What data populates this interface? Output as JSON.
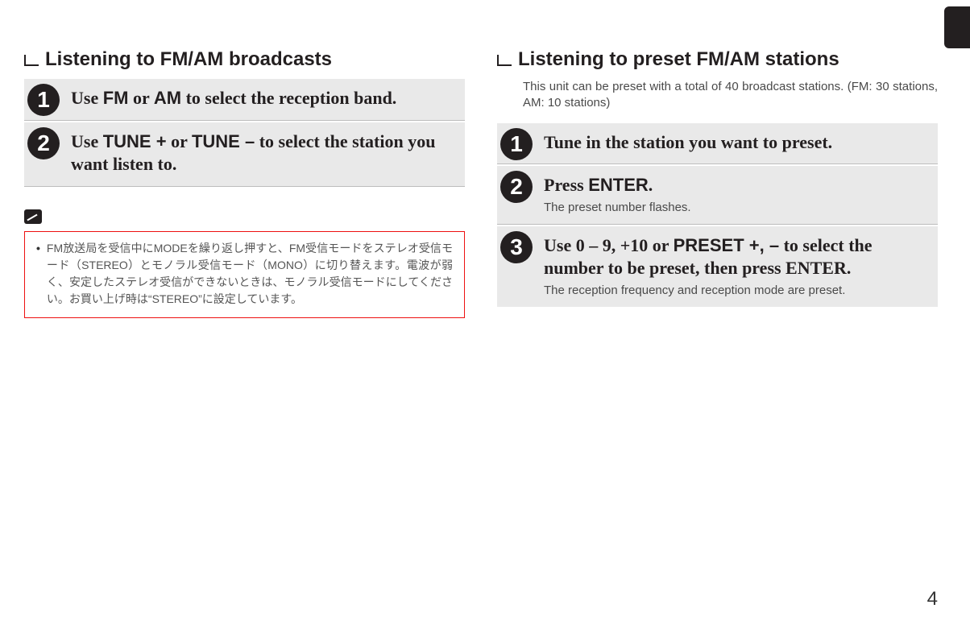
{
  "left": {
    "title": "Listening to FM/AM broadcasts",
    "steps": [
      {
        "num": "1",
        "main_pre": "Use ",
        "main_key1": "FM",
        "main_mid": " or ",
        "main_key2": "AM",
        "main_post": " to select the reception band."
      },
      {
        "num": "2",
        "main_pre": "Use ",
        "main_key1": "TUNE +",
        "main_mid": " or ",
        "main_key2": "TUNE –",
        "main_post": " to select the station you want listen to."
      }
    ],
    "note": "FM放送局を受信中にMODEを繰り返し押すと、FM受信モードをステレオ受信モード（STEREO）とモノラル受信モード（MONO）に切り替えます。電波が弱く、安定したステレオ受信ができないときは、モノラル受信モードにしてください。お買い上げ時は“STEREO”に設定しています。"
  },
  "right": {
    "title": "Listening to preset FM/AM stations",
    "intro": "This unit can be preset with a total of 40 broadcast stations. (FM: 30 stations, AM: 10 stations)",
    "steps": [
      {
        "num": "1",
        "main": "Tune in the station you want to preset.",
        "sub": ""
      },
      {
        "num": "2",
        "main_pre": "Press ",
        "main_key": "ENTER",
        "main_post": ".",
        "sub": "The preset number flashes."
      },
      {
        "num": "3",
        "main_pre": "Use 0 – 9, +10 or ",
        "main_key": "PRESET +, –",
        "main_post": " to select the number to be preset, then press ENTER.",
        "sub": "The reception frequency and reception mode are preset."
      }
    ]
  },
  "page_number": "4"
}
